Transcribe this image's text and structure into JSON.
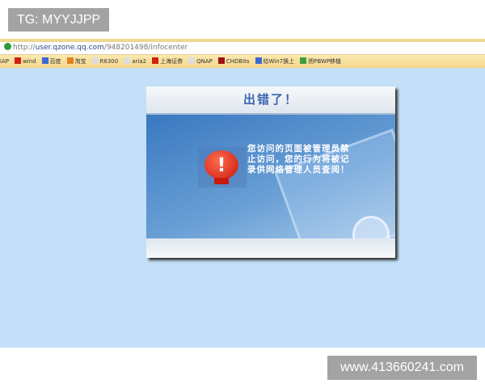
{
  "watermarks": {
    "top": "TG: MYYJJPP",
    "bottom": "www.413660241.com"
  },
  "browser": {
    "url_prefix": "http://",
    "url_host": "user.qzone.qq.com",
    "url_path": "/948201498/infocenter",
    "bookmarks": [
      {
        "label": "iAP"
      },
      {
        "label": "wind"
      },
      {
        "label": "百度"
      },
      {
        "label": "淘宝"
      },
      {
        "label": "R6300"
      },
      {
        "label": "aria2"
      },
      {
        "label": "上海证券"
      },
      {
        "label": "QNAP"
      },
      {
        "label": "CHDBits"
      },
      {
        "label": "给Win7换上"
      },
      {
        "label": "把PBWP移植"
      }
    ]
  },
  "dialog": {
    "title": "出错了！",
    "icon": "exclamation-icon",
    "message": "您访问的页面被管理员禁止访问，您的行为将被记录供网络管理人员查阅！"
  },
  "colors": {
    "background": "#c3e0f8",
    "title": "#3a64b0",
    "alert": "#c81a0a"
  }
}
